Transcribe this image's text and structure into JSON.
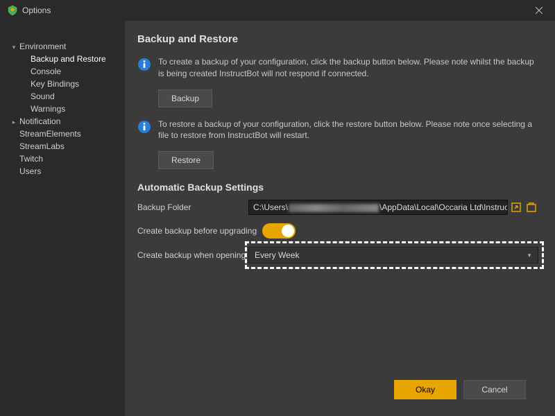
{
  "window": {
    "title": "Options"
  },
  "sidebar": {
    "items": [
      {
        "label": "Environment",
        "indent": 0,
        "expanded": true,
        "hasChildren": true
      },
      {
        "label": "Backup and Restore",
        "indent": 1,
        "selected": true
      },
      {
        "label": "Console",
        "indent": 1
      },
      {
        "label": "Key Bindings",
        "indent": 1
      },
      {
        "label": "Sound",
        "indent": 1
      },
      {
        "label": "Warnings",
        "indent": 1
      },
      {
        "label": "Notification",
        "indent": 0,
        "expanded": false,
        "hasChildren": true
      },
      {
        "label": "StreamElements",
        "indent": 0
      },
      {
        "label": "StreamLabs",
        "indent": 0
      },
      {
        "label": "Twitch",
        "indent": 0
      },
      {
        "label": "Users",
        "indent": 0
      }
    ]
  },
  "page": {
    "title": "Backup and Restore",
    "backup_info": "To create a backup of your configuration, click the backup button below. Please note whilst the backup is being created InstructBot will not respond if connected.",
    "backup_button": "Backup",
    "restore_info": "To restore a backup of your configuration, click the restore button below. Please note once selecting a file to restore from InstructBot will restart.",
    "restore_button": "Restore",
    "auto_section_title": "Automatic Backup Settings",
    "backup_folder_label": "Backup Folder",
    "backup_folder_prefix": "C:\\Users\\",
    "backup_folder_suffix": "\\AppData\\Local\\Occaria Ltd\\InstructBot\\backups\\",
    "before_upgrade_label": "Create backup before upgrading",
    "before_upgrade_value": true,
    "when_opening_label": "Create backup when opening",
    "when_opening_value": "Every Week"
  },
  "footer": {
    "okay": "Okay",
    "cancel": "Cancel"
  },
  "colors": {
    "accent": "#e8a500",
    "bg_dark": "#2a2a2a",
    "bg_panel": "#3b3b3b"
  }
}
